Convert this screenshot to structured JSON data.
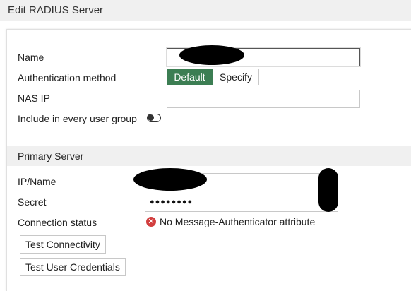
{
  "dialog": {
    "title": "Edit RADIUS Server"
  },
  "general": {
    "name_label": "Name",
    "auth_method_label": "Authentication method",
    "auth_methods": [
      "Default",
      "Specify"
    ],
    "auth_method_selected": "Default",
    "nas_ip_label": "NAS IP",
    "nas_ip_value": "",
    "include_all_groups_label": "Include in every user group",
    "include_all_groups_enabled": false
  },
  "primary_server": {
    "section_title": "Primary Server",
    "ip_name_label": "IP/Name",
    "secret_label": "Secret",
    "secret_masked": "●●●●●●●●",
    "connection_status_label": "Connection status",
    "connection_status_text": "No Message-Authenticator attribute",
    "connection_status_color": "#d23f3f",
    "test_connectivity_label": "Test Connectivity",
    "test_user_credentials_label": "Test User Credentials"
  },
  "colors": {
    "accent": "#3c7e53",
    "error": "#d23f3f"
  }
}
